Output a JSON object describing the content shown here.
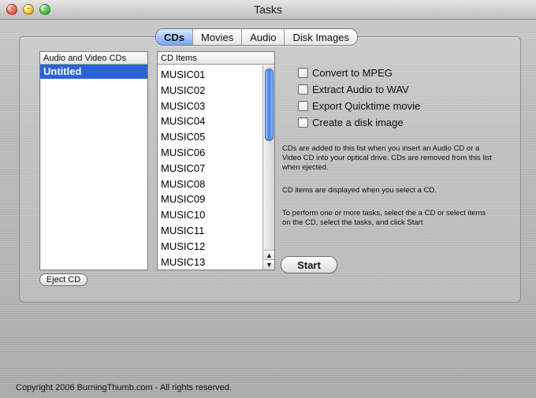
{
  "window": {
    "title": "Tasks"
  },
  "tabs": [
    {
      "label": "CDs",
      "active": true
    },
    {
      "label": "Movies",
      "active": false
    },
    {
      "label": "Audio",
      "active": false
    },
    {
      "label": "Disk Images",
      "active": false
    }
  ],
  "cds_list": {
    "header": "Audio and Video CDs",
    "items": [
      "Untitled"
    ],
    "selected_index": 0
  },
  "cd_items": {
    "header": "CD Items",
    "items": [
      "MUSIC01",
      "MUSIC02",
      "MUSIC03",
      "MUSIC04",
      "MUSIC05",
      "MUSIC06",
      "MUSIC07",
      "MUSIC08",
      "MUSIC09",
      "MUSIC10",
      "MUSIC11",
      "MUSIC12",
      "MUSIC13"
    ]
  },
  "tasks": [
    {
      "label": "Convert to MPEG"
    },
    {
      "label": "Extract Audio to WAV"
    },
    {
      "label": "Export Quicktime movie"
    },
    {
      "label": "Create a disk image"
    }
  ],
  "help": {
    "p1": "CDs are added to this list when you insert an Audio CD or a Video CD into your optical drive.  CDs are removed from this list when ejected.",
    "p2": "CD items are displayed when you select a CD.",
    "p3": "To perform one or more tasks, select the a CD or select items on the CD, select the tasks, and click Start"
  },
  "buttons": {
    "eject": "Eject CD",
    "start": "Start"
  },
  "footer": "Copyright 2006 BurningThumb.com - All rights reserved.",
  "colors": {
    "selection": "#2a63d6",
    "tab_active": "#74a7f6",
    "scroll_thumb": "#3f7fe6"
  },
  "icons": {
    "close": "close-icon",
    "minimize": "minimize-icon",
    "zoom": "zoom-icon",
    "scroll_up": "scroll-up-arrow-icon",
    "scroll_down": "scroll-down-arrow-icon"
  }
}
